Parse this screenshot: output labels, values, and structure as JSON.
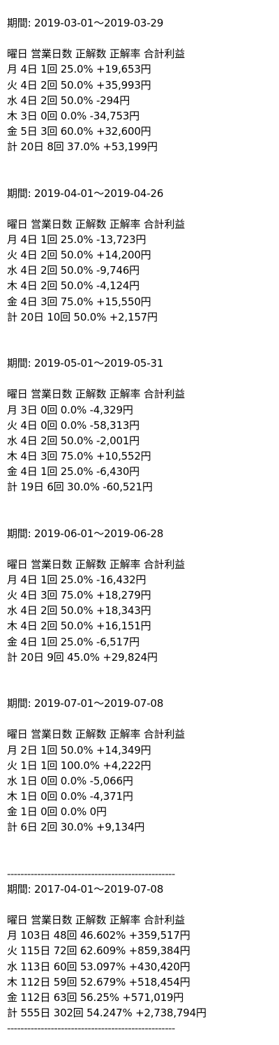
{
  "sections": [
    {
      "period": "期間: 2019-03-01〜2019-03-29",
      "header": "曜日 営業日数 正解数 正解率 合計利益",
      "rows": [
        "月 4日 1回 25.0% +19,653円",
        "火 4日 2回 50.0% +35,993円",
        "水 4日 2回 50.0% -294円",
        "木 3日 0回 0.0% -34,753円",
        "金 5日 3回 60.0% +32,600円",
        "計 20日 8回 37.0% +53,199円"
      ]
    },
    {
      "period": "期間: 2019-04-01〜2019-04-26",
      "header": "曜日 営業日数 正解数 正解率 合計利益",
      "rows": [
        "月 4日 1回 25.0% -13,723円",
        "火 4日 2回 50.0% +14,200円",
        "水 4日 2回 50.0% -9,746円",
        "木 4日 2回 50.0% -4,124円",
        "金 4日 3回 75.0% +15,550円",
        "計 20日 10回 50.0% +2,157円"
      ]
    },
    {
      "period": "期間: 2019-05-01〜2019-05-31",
      "header": "曜日 営業日数 正解数 正解率 合計利益",
      "rows": [
        "月 3日 0回 0.0% -4,329円",
        "火 4日 0回 0.0% -58,313円",
        "水 4日 2回 50.0% -2,001円",
        "木 4日 3回 75.0% +10,552円",
        "金 4日 1回 25.0% -6,430円",
        "計 19日 6回 30.0% -60,521円"
      ]
    },
    {
      "period": "期間: 2019-06-01〜2019-06-28",
      "header": "曜日 営業日数 正解数 正解率 合計利益",
      "rows": [
        "月 4日 1回 25.0% -16,432円",
        "火 4日 3回 75.0% +18,279円",
        "水 4日 2回 50.0% +18,343円",
        "木 4日 2回 50.0% +16,151円",
        "金 4日 1回 25.0% -6,517円",
        "計 20日 9回 45.0% +29,824円"
      ]
    },
    {
      "period": "期間: 2019-07-01〜2019-07-08",
      "header": "曜日 営業日数 正解数 正解率 合計利益",
      "rows": [
        "月 2日 1回 50.0% +14,349円",
        "火 1日 1回 100.0% +4,222円",
        "水 1日 0回 0.0% -5,066円",
        "木 1日 0回 0.0% -4,371円",
        "金 1日 0回 0.0% 0円",
        "計 6日 2回 30.0% +9,134円"
      ]
    }
  ],
  "divider": "--------------------------------------------------",
  "summary": {
    "period": "期間: 2017-04-01〜2019-07-08",
    "header": "曜日 営業日数 正解数 正解率 合計利益",
    "rows": [
      "月 103日 48回 46.602% +359,517円",
      "火 115日 72回 62.609% +859,384円",
      "水 113日 60回 53.097% +430,420円",
      "木 112日 59回 52.679% +518,454円",
      "金 112日 63回 56.25% +571,019円",
      "計 555日 302回 54.247% +2,738,794円"
    ]
  }
}
